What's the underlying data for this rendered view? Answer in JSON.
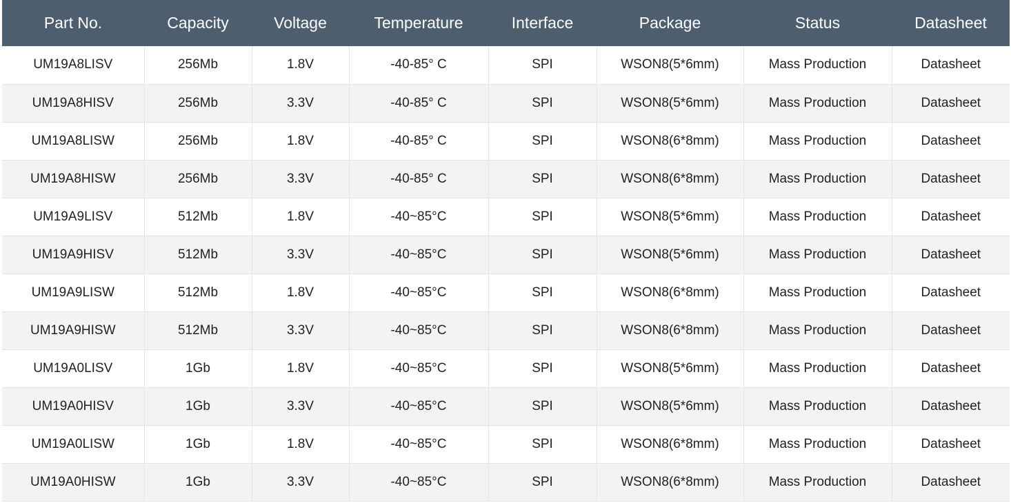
{
  "table": {
    "headers": [
      "Part No.",
      "Capacity",
      "Voltage",
      "Temperature",
      "Interface",
      "Package",
      "Status",
      "Datasheet"
    ],
    "rows": [
      [
        "UM19A8LISV",
        "256Mb",
        "1.8V",
        "-40-85° C",
        "SPI",
        "WSON8(5*6mm)",
        "Mass Production",
        "Datasheet"
      ],
      [
        "UM19A8HISV",
        "256Mb",
        "3.3V",
        "-40-85° C",
        "SPI",
        "WSON8(5*6mm)",
        "Mass Production",
        "Datasheet"
      ],
      [
        "UM19A8LISW",
        "256Mb",
        "1.8V",
        "-40-85° C",
        "SPI",
        "WSON8(6*8mm)",
        "Mass Production",
        "Datasheet"
      ],
      [
        "UM19A8HISW",
        "256Mb",
        "3.3V",
        "-40-85° C",
        "SPI",
        "WSON8(6*8mm)",
        "Mass Production",
        "Datasheet"
      ],
      [
        "UM19A9LISV",
        "512Mb",
        "1.8V",
        "-40~85°C",
        "SPI",
        "WSON8(5*6mm)",
        "Mass Production",
        "Datasheet"
      ],
      [
        "UM19A9HISV",
        "512Mb",
        "3.3V",
        "-40~85°C",
        "SPI",
        "WSON8(5*6mm)",
        "Mass Production",
        "Datasheet"
      ],
      [
        "UM19A9LISW",
        "512Mb",
        "1.8V",
        "-40~85°C",
        "SPI",
        "WSON8(6*8mm)",
        "Mass Production",
        "Datasheet"
      ],
      [
        "UM19A9HISW",
        "512Mb",
        "3.3V",
        "-40~85°C",
        "SPI",
        "WSON8(6*8mm)",
        "Mass Production",
        "Datasheet"
      ],
      [
        "UM19A0LISV",
        "1Gb",
        "1.8V",
        "-40~85°C",
        "SPI",
        "WSON8(5*6mm)",
        "Mass Production",
        "Datasheet"
      ],
      [
        "UM19A0HISV",
        "1Gb",
        "3.3V",
        "-40~85°C",
        "SPI",
        "WSON8(5*6mm)",
        "Mass Production",
        "Datasheet"
      ],
      [
        "UM19A0LISW",
        "1Gb",
        "1.8V",
        "-40~85°C",
        "SPI",
        "WSON8(6*8mm)",
        "Mass Production",
        "Datasheet"
      ],
      [
        "UM19A0HISW",
        "1Gb",
        "3.3V",
        "-40~85°C",
        "SPI",
        "WSON8(6*8mm)",
        "Mass Production",
        "Datasheet"
      ]
    ]
  },
  "colors": {
    "header_bg": "#4d5e6e",
    "header_text": "#ffffff",
    "row_alt_bg": "#f3f3f3"
  }
}
